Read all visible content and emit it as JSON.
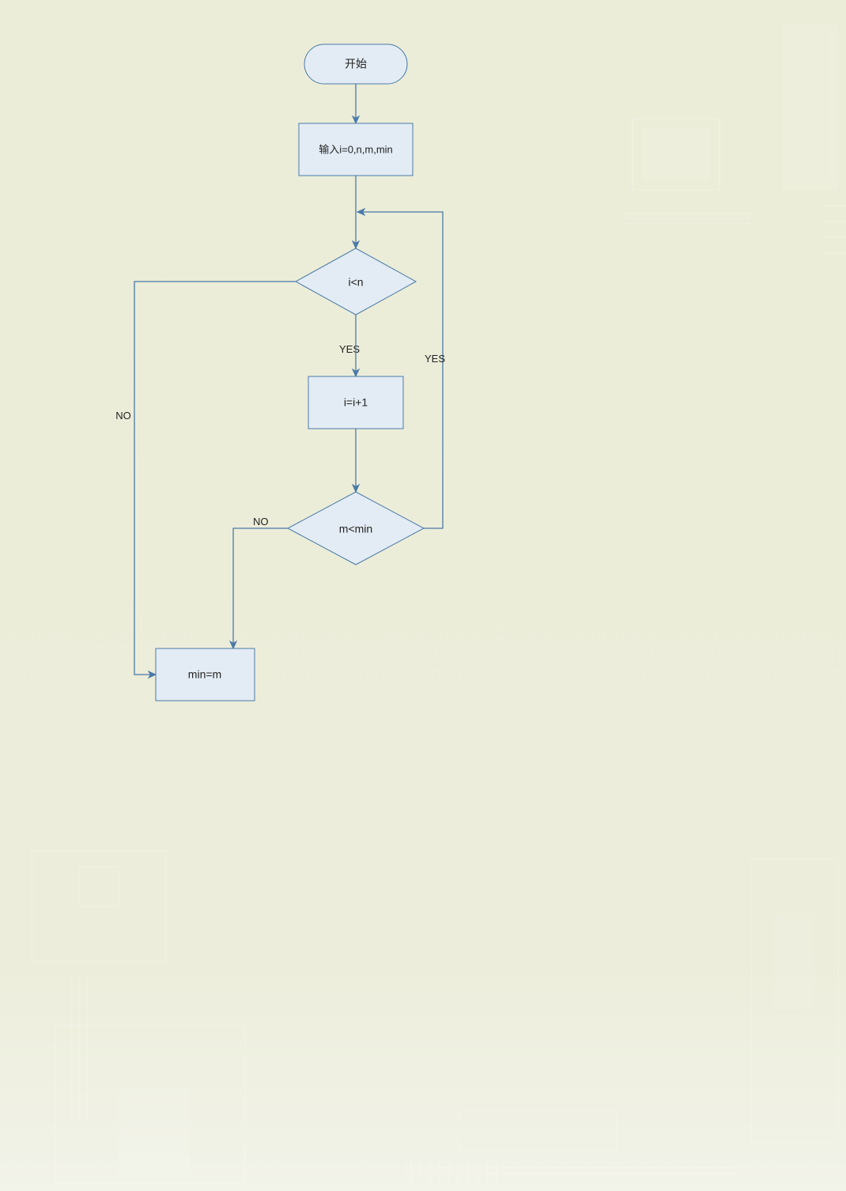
{
  "flowchart": {
    "nodes": {
      "start": {
        "label": "开始"
      },
      "input": {
        "label": "输入i=0,n,m,min"
      },
      "cond1": {
        "label": "i<n"
      },
      "inc": {
        "label": "i=i+1"
      },
      "cond2": {
        "label": "m<min"
      },
      "assign": {
        "label": "min=m"
      }
    },
    "edges": {
      "cond1_yes": "YES",
      "cond1_no": "NO",
      "cond2_yes": "YES",
      "cond2_no": "NO"
    }
  },
  "colors": {
    "node_fill": "#e3ecf4",
    "node_stroke": "#4a7aa8",
    "background": "#ecedda"
  }
}
